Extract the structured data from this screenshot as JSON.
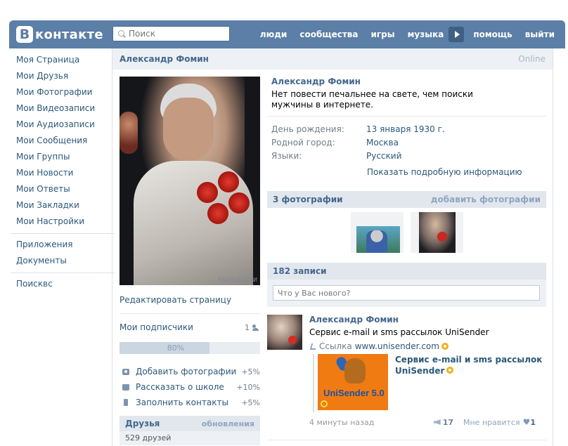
{
  "header": {
    "logo_letter": "B",
    "logo_text": "контакте",
    "search_placeholder": "Поиск",
    "nav": [
      "люди",
      "сообщества",
      "игры",
      "музыка",
      "помощь",
      "выйти"
    ]
  },
  "leftmenu": {
    "items": [
      "Моя Страница",
      "Мои Друзья",
      "Мои Фотографии",
      "Мои Видеозаписи",
      "Мои Аудиозаписи",
      "Мои Сообщения",
      "Мои Группы",
      "Мои Новости",
      "Мои Ответы",
      "Мои Закладки",
      "Мои Настройки"
    ],
    "items2": [
      "Приложения",
      "Документы"
    ],
    "items3": [
      "Поисквс"
    ]
  },
  "profile": {
    "name": "Александр Фомин",
    "online": "Online",
    "photo_watermark": "РИАНОВОСТИ",
    "edit_label": "Редактировать страницу",
    "subscribers_label": "Мои подписчики",
    "subscribers_count": "1",
    "progress_label": "80%",
    "progress_fraction": 0.8,
    "tasks": [
      {
        "label": "Добавить фотографии",
        "pct": "+5%",
        "icon": "camera-icon"
      },
      {
        "label": "Рассказать о школе",
        "pct": "+10%",
        "icon": "briefcase-icon"
      },
      {
        "label": "Заполнить контакты",
        "pct": "+5%",
        "icon": "phone-icon"
      }
    ],
    "friends_title": "Друзья",
    "friends_updates": "обновления",
    "friends_count": "529 друзей",
    "status": "Нет повести печальнее на свете, чем поиски мужчины в интернете.",
    "info": [
      {
        "k": "День рождения:",
        "v": "13 января 1930 г."
      },
      {
        "k": "Родной город:",
        "v": "Москва"
      },
      {
        "k": "Языки:",
        "v": "Русский"
      }
    ],
    "show_more": "Показать подробную информацию",
    "photos_title": "3 фотографии",
    "photos_add": "добавить фотографии",
    "posts_title": "182 записи",
    "composer_placeholder": "Что у Вас нового?",
    "post": {
      "author": "Александр Фомин",
      "text": "Сервис e-mail и sms рассылок UniSender",
      "link_prefix": "Ссылка",
      "link_url": "www.unisender.com",
      "attach_title": "Сервис e-mail и sms рассылок UniSender",
      "attach_brand": "UniSender 5.0",
      "time": "4 минуты назад",
      "reposts": "17",
      "like_label": "Мне нравится",
      "likes": "1"
    }
  },
  "colors": {
    "header_bg": "#5b7fa6",
    "link": "#2b587a",
    "section_bg": "#e1e7ed"
  }
}
